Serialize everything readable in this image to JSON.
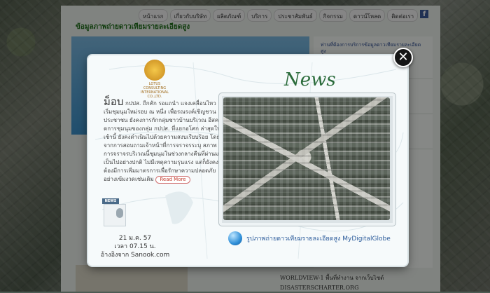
{
  "site": {
    "nav": [
      "หน้าแรก",
      "เกี่ยวกับบริษัท",
      "ผลิตภัณฑ์",
      "บริการ",
      "ประชาสัมพันธ์",
      "กิจกรรม",
      "ดาวน์โหลด",
      "ติดต่อเรา"
    ],
    "facebook_icon": "f",
    "section_title": "ข้อมูลภาพถ่ายดาวเทียมรายละเอียดสูง",
    "side_ad": "ท่านที่ต้องการบริการข้อมูลดาวเทียมรายละเอียดสูง",
    "footer_links": [
      "WORLDVIEW-1 พื้นที่ทำงาน จากเว็บไซต์",
      "DISASTERSCHARTER.ORG"
    ]
  },
  "modal": {
    "logo_text": "LOTUS CONSULTING INTERNATIONAL CO.,LTD.",
    "article_lead": "ม็อบ",
    "article_body": "กปปส. ถีกคัก รอแถนำ แจงเคลื่อนไหวเริ่มชุมนุมใหม่รอบ ณ หนึ่ง เพื่อรณรงค์เชิญชวนประชาชน ยังคงการกักกลุ่มชาวบ้านบริเวณ อีสคร์ดการชุมนุมของกลุ่ม กปปส. ที่แยกอโศก ล่าสุดในเช้านี้ ยังคงดำเนินไปด้วยความสงบเรียบร้อย โดยจากการสอบถามเจ้าหน้าที่การจราจรระบุ สภาพการจราจรบริเวณนี้ชุมนุมในช่วงกลางคืนที่ผ่านมาเป็นไปอย่างปกติ ไม่มีเหตุความรุนแรง แต่ก็ยังคงต้องมีการเพิ่มมาตรการเพื่อรักษาความปลอดภัยอย่างเข้มงวดเช่นเดิม",
    "read_more": "Read More",
    "news_badge": "NEWS",
    "date": "21 ม.ค. 57",
    "time": "เวลา 07.15 น.",
    "source": "อ้างอิงจาก Sanook.com",
    "news_heading": "News",
    "caption": "รูปภาพถ่ายดาวเทียมรายละเอียดสูง MyDigitalGlobe",
    "close_symbol": "✕"
  }
}
